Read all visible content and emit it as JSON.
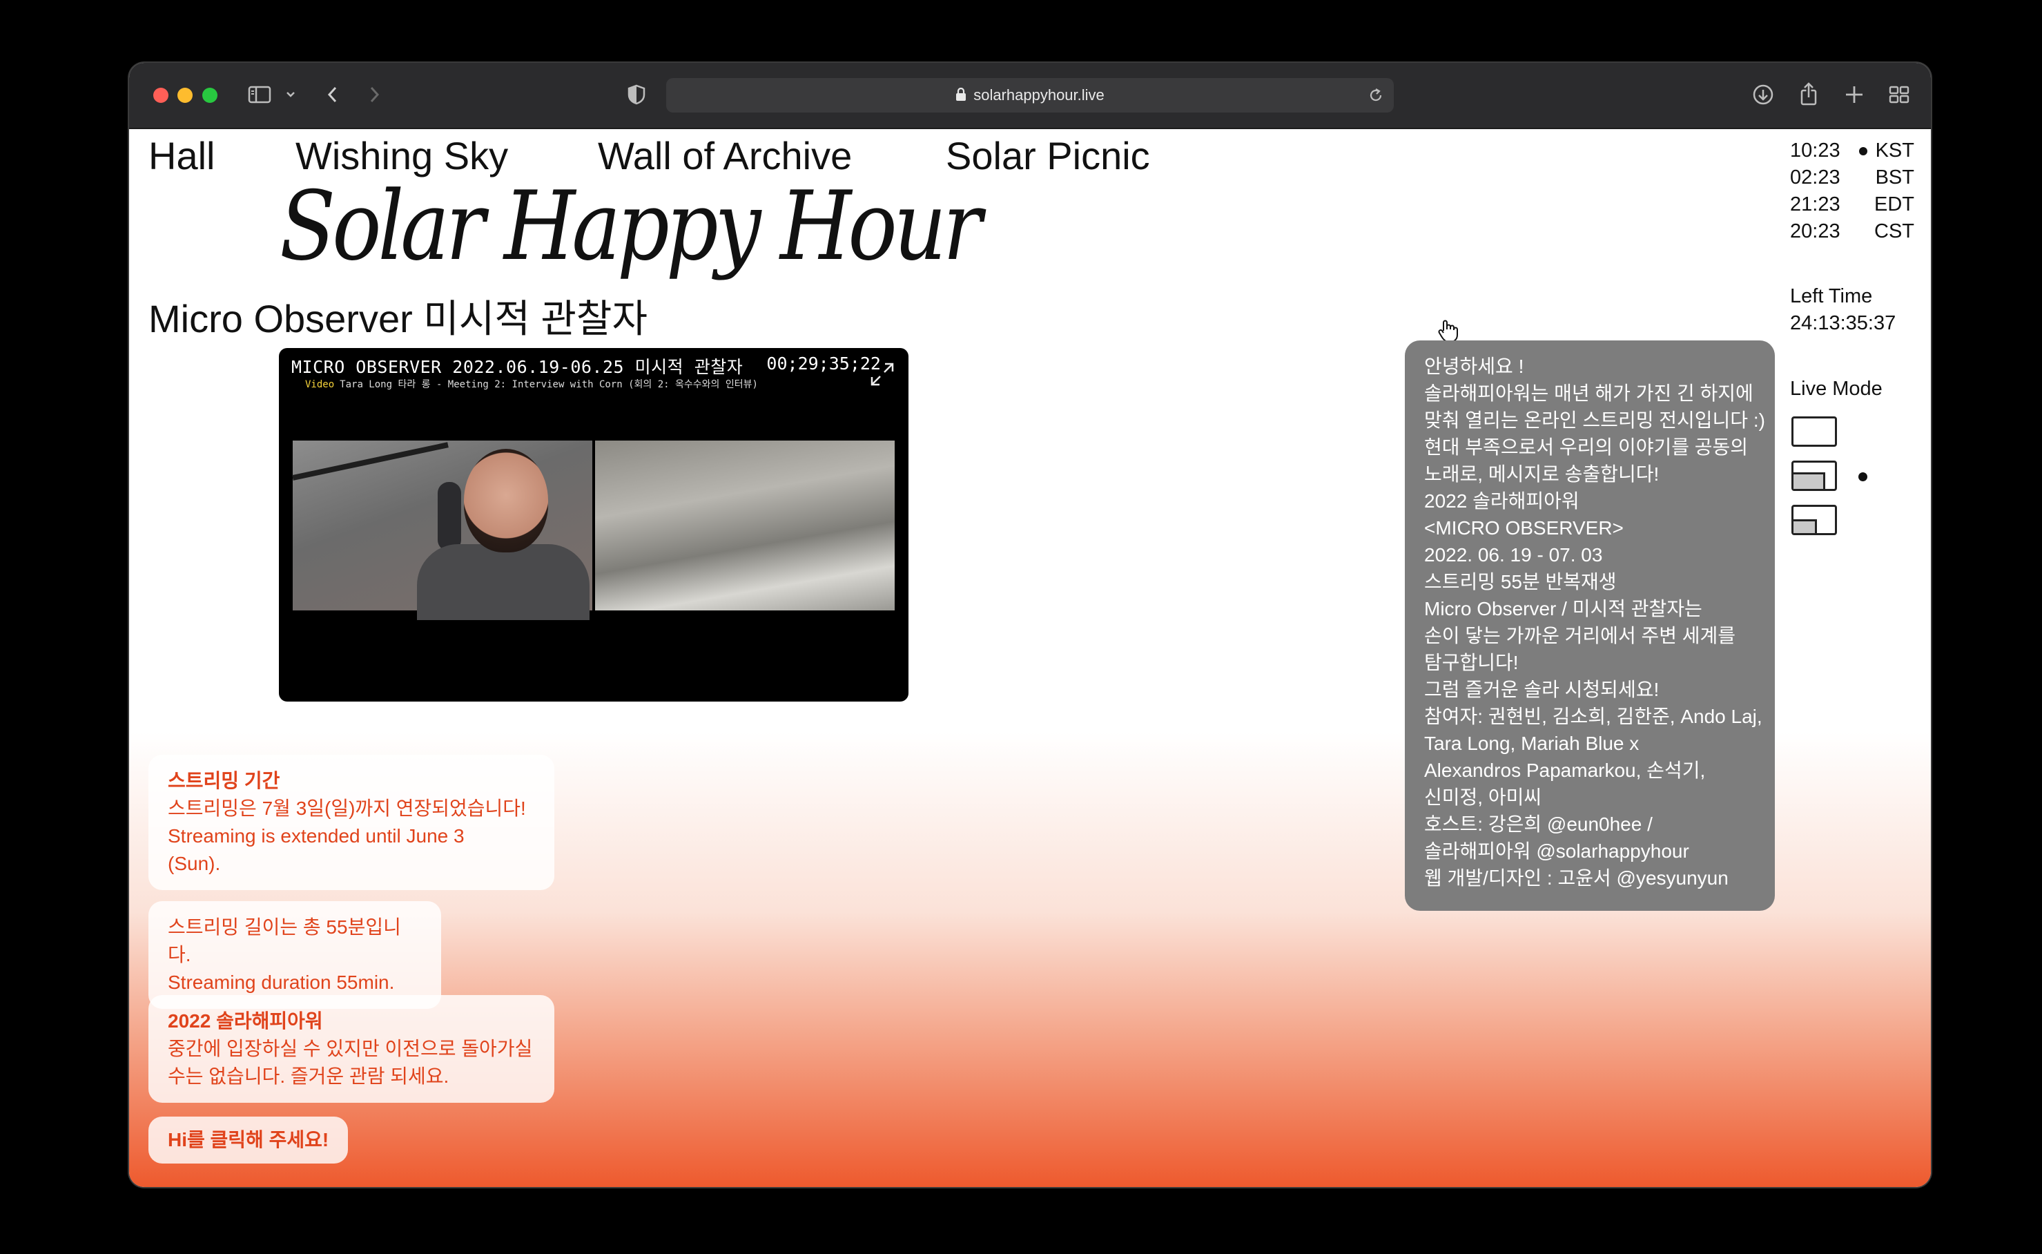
{
  "browser": {
    "url": "solarhappyhour.live"
  },
  "nav": [
    {
      "label": "Hall"
    },
    {
      "label": "Wishing Sky"
    },
    {
      "label": "Wall of Archive"
    },
    {
      "label": "Solar Picnic"
    }
  ],
  "logo": "Solar Happy Hour",
  "page_title": "Micro Observer 미시적 관찰자",
  "video": {
    "title": "MICRO OBSERVER 2022.06.19-06.25 미시적 관찰자",
    "timer": "00;29;35;22",
    "caption_tag": "Video",
    "caption": "Tara Long 타라 롱 - Meeting 2: Interview with Corn (회의 2: 옥수수와의 인터뷰)"
  },
  "notices": {
    "streaming_period": {
      "heading": "스트리밍 기간",
      "line1": "스트리밍은 7월 3일(일)까지 연장되었습니다!",
      "line2": "Streaming is extended until June 3",
      "line3": "(Sun)."
    },
    "duration": {
      "line1": "스트리밍 길이는 총 55분입니다.",
      "line2": "Streaming duration 55min."
    },
    "year": {
      "heading": "2022 솔라해피아워",
      "line1": "중간에 입장하실 수 있지만 이전으로 돌아가실",
      "line2": "수는 없습니다. 즐거운 관람 되세요."
    },
    "hi_button": "Hi를 클릭해 주세요!"
  },
  "info_lines": [
    "안녕하세요 !",
    "솔라해피아워는 매년 해가 가진 긴 하지에",
    "맞춰 열리는 온라인 스트리밍 전시입니다 :)",
    "현대 부족으로서 우리의 이야기를 공동의",
    "노래로, 메시지로 송출합니다!",
    "2022 솔라해피아워",
    "<MICRO OBSERVER>",
    "2022. 06. 19 - 07. 03",
    "스트리밍 55분 반복재생",
    "Micro Observer / 미시적 관찰자는",
    "손이 닿는 가까운 거리에서 주변 세계를",
    "탐구합니다!",
    "그럼 즐거운 솔라 시청되세요!",
    "참여자: 권현빈, 김소희, 김한준, Ando Laj,",
    "Tara Long, Mariah Blue x",
    "Alexandros Papamarkou, 손석기,",
    "신미정, 아미씨",
    "호스트: 강은희 @eun0hee /",
    "솔라해피아워 @solarhappyhour",
    "웹 개발/디자인 : 고윤서 @yesyunyun"
  ],
  "clocks": [
    {
      "time": "10:23",
      "zone": "KST"
    },
    {
      "time": "02:23",
      "zone": "BST"
    },
    {
      "time": "21:23",
      "zone": "EDT"
    },
    {
      "time": "20:23",
      "zone": "CST"
    }
  ],
  "left_time": {
    "label": "Left Time",
    "value": "24:13:35:37"
  },
  "live_mode": {
    "label": "Live Mode",
    "selected": "picture-in-picture"
  },
  "colors": {
    "accent": "#e0431b",
    "gradient_end": "#ee5a2e",
    "info_panel": "#7d7d7d",
    "titlebar": "#2b2b2d"
  }
}
